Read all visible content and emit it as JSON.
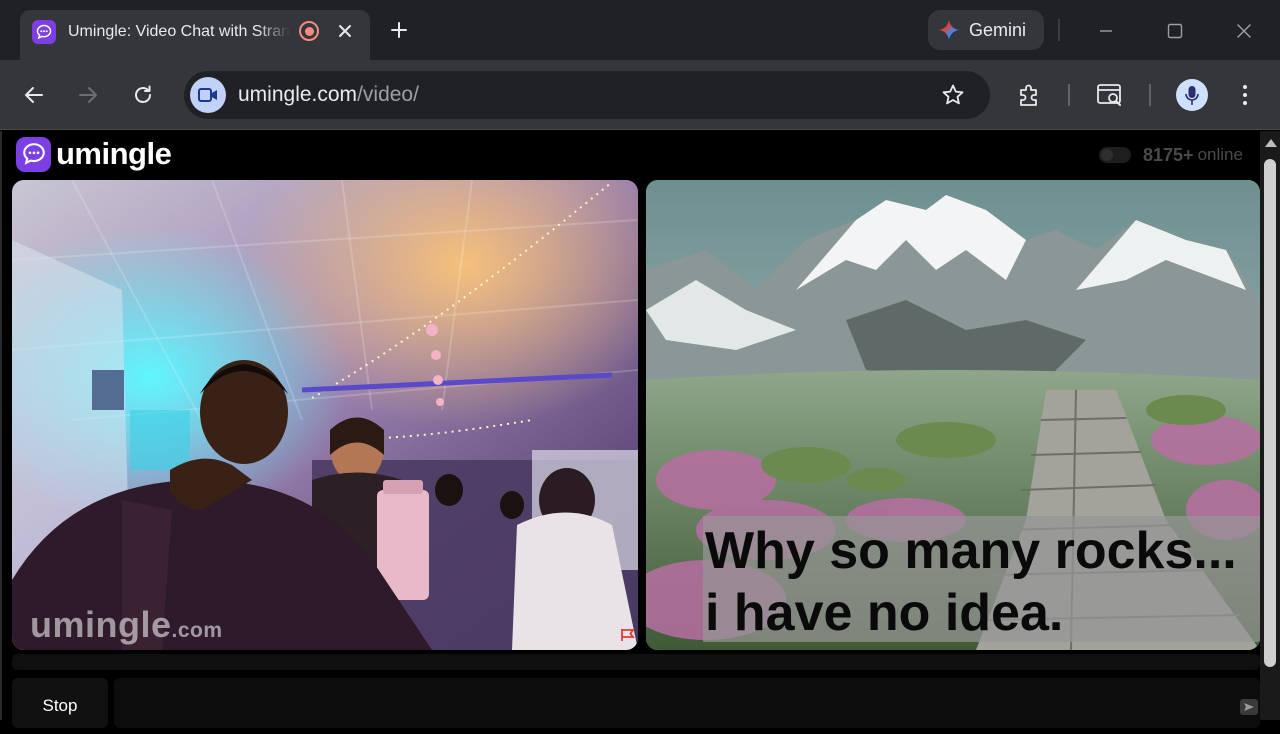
{
  "browser": {
    "tab": {
      "title": "Umingle: Video Chat with Strangers"
    },
    "gemini_label": "Gemini",
    "url": {
      "host": "umingle.com",
      "path": "/video/"
    }
  },
  "site": {
    "logo_text": "umingle",
    "online_count": "8175+",
    "online_label": "online"
  },
  "video": {
    "watermark_main": "umingle",
    "watermark_suffix": ".com",
    "caption_line1": "Why so many rocks...",
    "caption_line2": "i have no idea."
  },
  "controls": {
    "stop_label": "Stop"
  },
  "colors": {
    "brand": "#7b3fe4",
    "chrome_dark": "#202124",
    "chrome_toolbar": "#35363a"
  }
}
